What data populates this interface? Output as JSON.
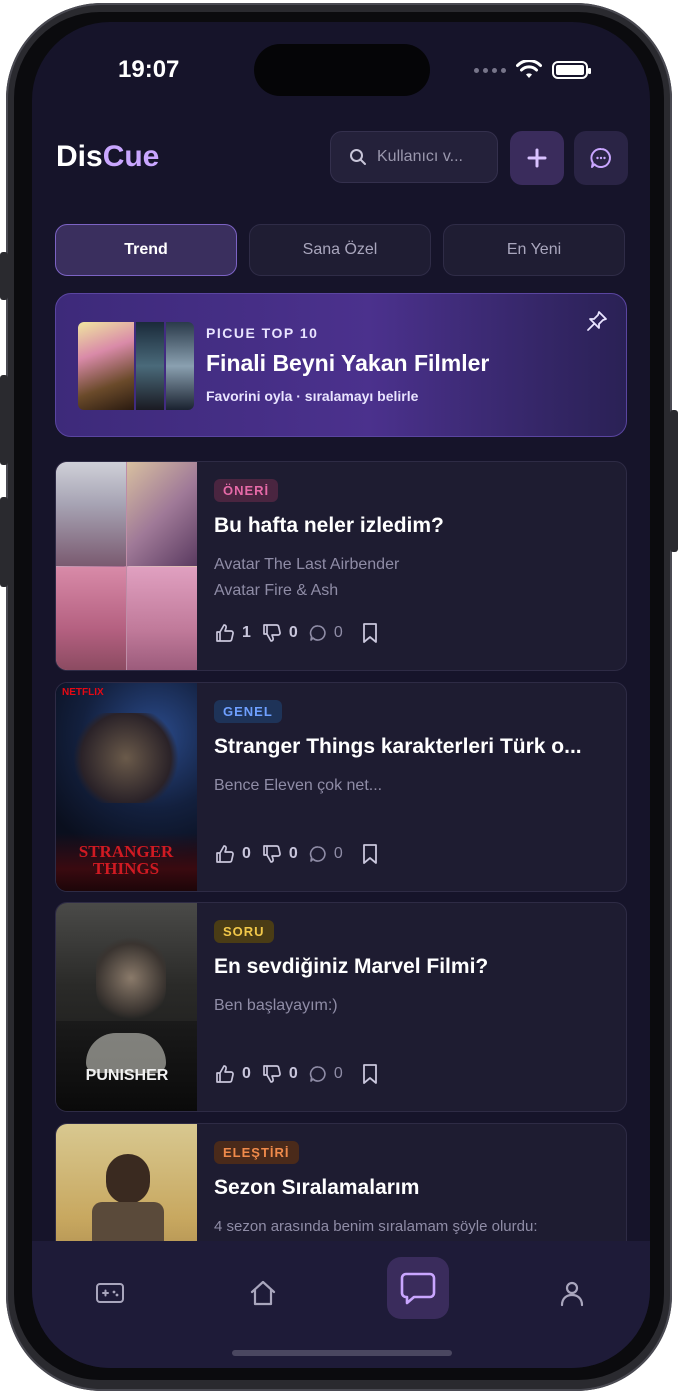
{
  "status": {
    "time": "19:07"
  },
  "header": {
    "logo_part1": "Dis",
    "logo_part2": "Cue",
    "search_placeholder": "Kullanıcı v...",
    "add_icon": "plus-icon",
    "chat_icon": "chat-bubble-icon"
  },
  "tabs": [
    {
      "label": "Trend",
      "active": true
    },
    {
      "label": "Sana Özel",
      "active": false
    },
    {
      "label": "En Yeni",
      "active": false
    }
  ],
  "featured": {
    "kicker": "PICUE TOP 10",
    "title": "Finali Beyni Yakan Filmler",
    "subtitle": "Favorini oyla · sıralamayı belirle",
    "pin_icon": "pin-icon"
  },
  "posts": [
    {
      "badge": "ÖNERİ",
      "badge_color": "#e66aa8",
      "title": "Bu hafta neler izledim?",
      "lines": [
        "Avatar The Last Airbender",
        "Avatar Fire & Ash"
      ],
      "likes": "1",
      "dislikes": "0",
      "comments": "0"
    },
    {
      "badge": "GENEL",
      "badge_color": "#6fa0ff",
      "title": "Stranger Things karakterleri Türk o...",
      "lines": [
        "Bence Eleven çok net..."
      ],
      "likes": "0",
      "dislikes": "0",
      "comments": "0"
    },
    {
      "badge": "SORU",
      "badge_color": "#f1c84a",
      "title": "En sevdiğiniz Marvel Filmi?",
      "lines": [
        "Ben başlayayım:)"
      ],
      "likes": "0",
      "dislikes": "0",
      "comments": "0"
    },
    {
      "badge": "ELEŞTİRİ",
      "badge_color": "#f08a4b",
      "title": "Sezon Sıralamalarım",
      "lines": [
        "4 sezon arasında benim sıralamam şöyle olurdu:"
      ],
      "likes": "",
      "dislikes": "",
      "comments": ""
    }
  ],
  "bottom_nav": [
    {
      "icon": "gamepad-icon"
    },
    {
      "icon": "home-icon"
    },
    {
      "icon": "chat-icon",
      "active": true
    },
    {
      "icon": "profile-icon"
    }
  ],
  "colors": {
    "accent": "#c9a6ff",
    "background": "#16142a",
    "card": "#1e1c31"
  }
}
